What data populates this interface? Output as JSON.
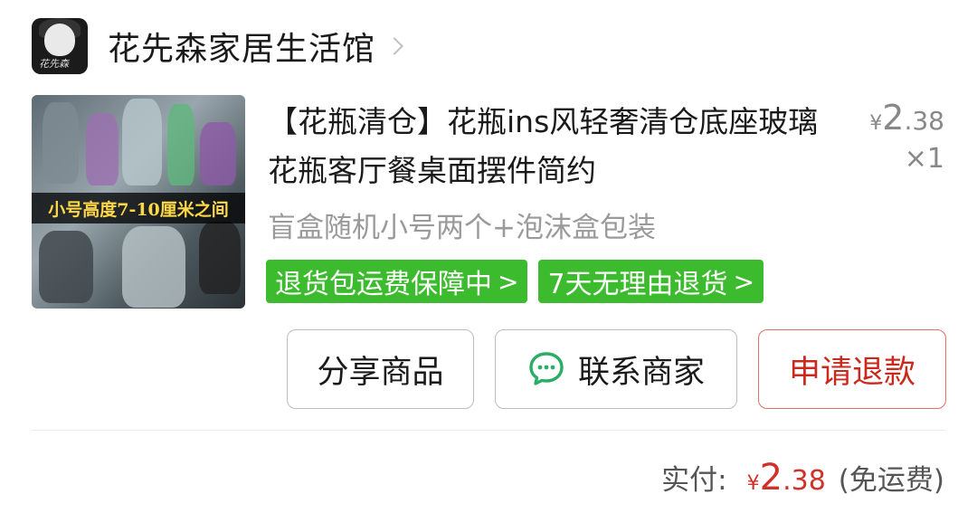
{
  "shop": {
    "name": "花先森家居生活馆",
    "avatar_signature": "花先森"
  },
  "product": {
    "title": "【花瓶清仓】花瓶ins风轻奢清仓底座玻璃花瓶客厅餐桌面摆件简约",
    "image_banner": "小号高度7-10厘米之间",
    "spec": "盲盒随机小号两个+泡沫盒包装",
    "price_symbol": "¥",
    "price_int": "2",
    "price_dec": ".38",
    "quantity": "×1",
    "tags": [
      {
        "label": "退货包运费保障中",
        "arrow": ">"
      },
      {
        "label": "7天无理由退货",
        "arrow": ">"
      }
    ]
  },
  "actions": {
    "share_label": "分享商品",
    "contact_label": "联系商家",
    "refund_label": "申请退款"
  },
  "summary": {
    "paid_label": "实付:",
    "currency": "¥",
    "amount_int": "2",
    "amount_dec": ".38",
    "shipping_note": "(免运费)"
  },
  "colors": {
    "tag_green": "#3dbb2e",
    "refund_red": "#c92a1e",
    "price_red": "#d0312a",
    "wechat_green": "#2aae67"
  }
}
